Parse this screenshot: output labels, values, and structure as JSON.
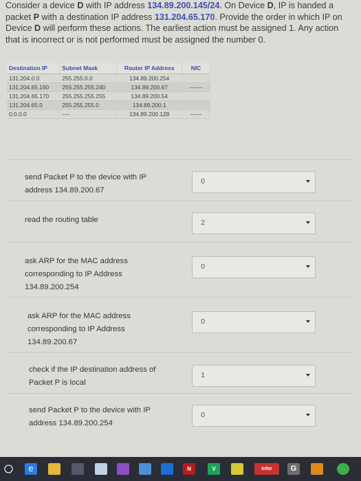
{
  "question": {
    "p1": "Consider a device ",
    "device": "D",
    "p2": " with IP address ",
    "ip_src": "134.89.200.145/24",
    "p3": ". On Device ",
    "device2": "D",
    "p4": ", IP is handed a packet ",
    "packet": "P",
    "p5": " with a destination IP address ",
    "ip_dst": "131.204.65.170",
    "p6": ". Provide the order in which IP on Device ",
    "device3": "D",
    "p7": " will perform these actions. The earliest action must be assigned 1. Any action that is incorrect or is not performed must be assigned the number 0."
  },
  "routing_table": {
    "headers": [
      "Destination IP",
      "Subnet Mask",
      "Router IP Address",
      "NIC"
    ],
    "rows": [
      {
        "dest": "131.204.0.0",
        "mask": "255.255.0.0",
        "router": "134.89.200.254",
        "nic": ""
      },
      {
        "dest": "131.204.65.160",
        "mask": "255.255.255.240",
        "router": "134.89.200.67",
        "nic": "-------"
      },
      {
        "dest": "131.204.65.170",
        "mask": "255.255.255.255",
        "router": "134.89.200.54",
        "nic": ""
      },
      {
        "dest": "131.204.65.0",
        "mask": "255.255.255.0",
        "router": "134.89.200.1",
        "nic": ""
      },
      {
        "dest": "0.0.0.0",
        "mask": "----",
        "router": "134.89.200.128",
        "nic": "------"
      }
    ]
  },
  "actions": [
    {
      "label": "send Packet P to the device with IP address 134.89.200.67",
      "value": "0"
    },
    {
      "label": "read the routing table",
      "value": "2"
    },
    {
      "label": "ask ARP for the MAC address corresponding to IP Address 134.89.200.254",
      "value": "0"
    },
    {
      "label": "ask ARP for the MAC address corresponding to IP Address 134.89.200.67",
      "value": "0"
    },
    {
      "label": "check if the IP destination address of Packet P is local",
      "value": "1"
    },
    {
      "label": "send Packet P to the device with IP address 134.89.200.254",
      "value": "0"
    }
  ],
  "taskbar": {
    "items": [
      {
        "icon": "windows-icon",
        "text": "",
        "color": "#1e1f29"
      },
      {
        "icon": "edge-icon",
        "text": "e",
        "color": "#2a7be4"
      },
      {
        "icon": "file-explorer-icon",
        "text": "",
        "color": "#e7b73d"
      },
      {
        "icon": "store-icon",
        "text": "",
        "color": "#555a6a"
      },
      {
        "icon": "paint-icon",
        "text": "",
        "color": "#c3d1e6"
      },
      {
        "icon": "onenote-icon",
        "text": "",
        "color": "#8a4fc0"
      },
      {
        "icon": "photos-icon",
        "text": "",
        "color": "#4f8fd6"
      },
      {
        "icon": "outlook-icon",
        "text": "",
        "color": "#1b6fd1"
      },
      {
        "icon": "netflix-icon",
        "text": "N",
        "color": "#b21d1d"
      },
      {
        "icon": "vine-icon",
        "text": "V",
        "color": "#1ea35c"
      },
      {
        "icon": "arrow-app-icon",
        "text": "",
        "color": "#d5c83a"
      },
      {
        "icon": "infor-icon",
        "text": "Infor",
        "color": "#c73232"
      },
      {
        "icon": "g-app-icon",
        "text": "G",
        "color": "#6f6f6f"
      },
      {
        "icon": "orange-app-icon",
        "text": "",
        "color": "#e08a1e"
      },
      {
        "icon": "green-app-icon",
        "text": "",
        "color": "#3fae48"
      }
    ]
  }
}
